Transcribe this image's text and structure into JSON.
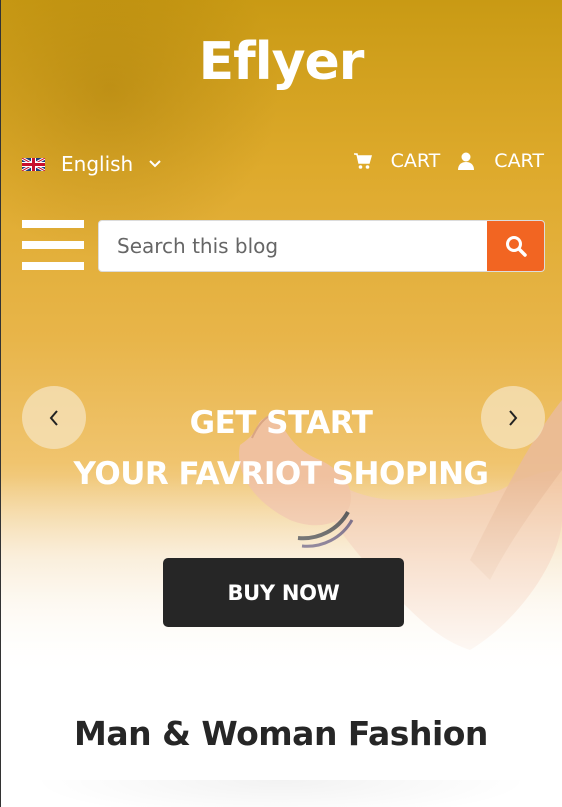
{
  "brand": {
    "logo_text": "Eflyer"
  },
  "language": {
    "selected": "English",
    "flag_icon": "uk-flag-icon",
    "dropdown_icon": "chevron-down-icon"
  },
  "header_links": [
    {
      "icon": "shopping-cart-icon",
      "label": "CART"
    },
    {
      "icon": "user-icon",
      "label": "CART"
    }
  ],
  "menu": {
    "icon": "hamburger-menu-icon"
  },
  "search": {
    "placeholder": "Search this blog",
    "value": "",
    "button_icon": "search-icon"
  },
  "hero": {
    "headline_line1": "GET START",
    "headline_line2": "YOUR FAVRIOT SHOPING",
    "cta_label": "BUY NOW",
    "prev_icon": "chevron-left-icon",
    "next_icon": "chevron-right-icon"
  },
  "section": {
    "title": "Man & Woman Fashion"
  },
  "colors": {
    "accent": "#f26522",
    "dark": "#262626",
    "hero_top": "#c99a14",
    "hero_mid": "#e8b54a"
  }
}
